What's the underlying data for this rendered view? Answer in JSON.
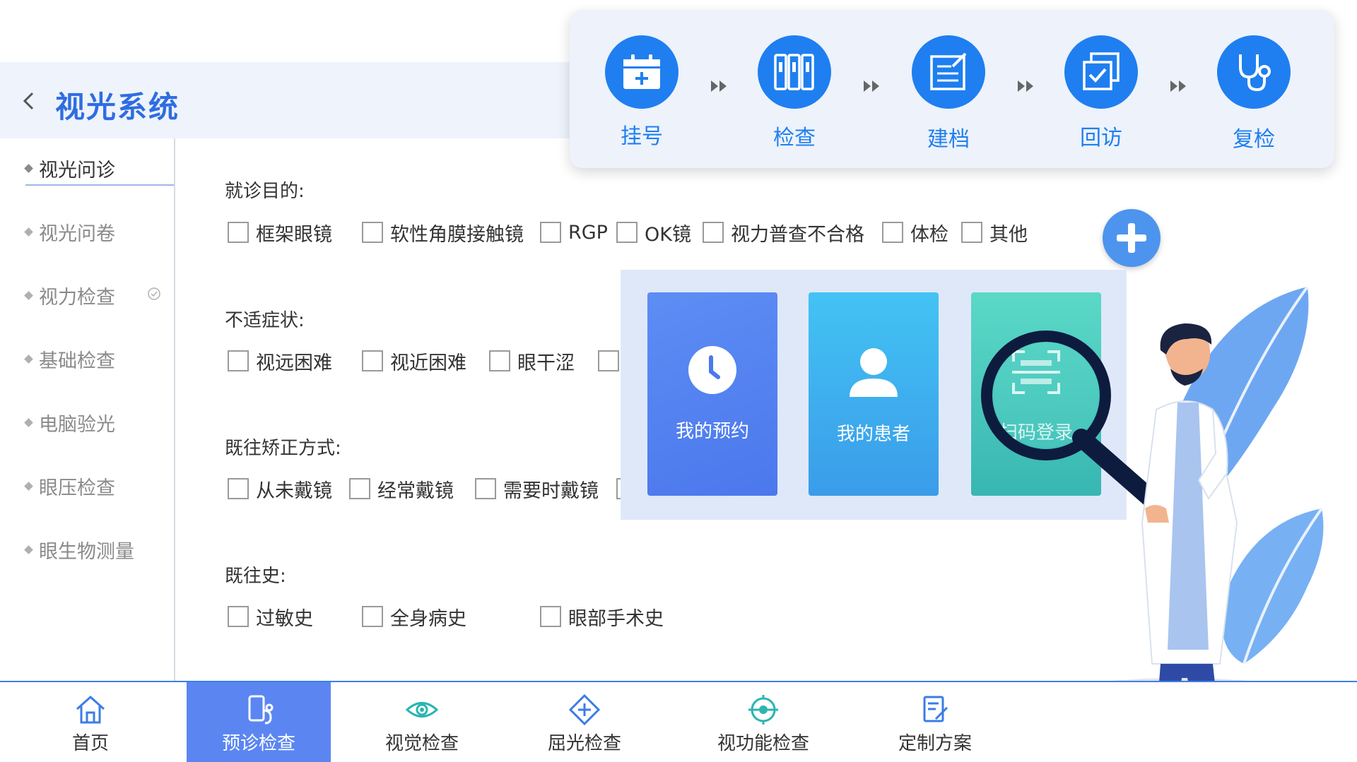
{
  "header": {
    "title": "视光系统",
    "back_icon": "chevron-left-icon"
  },
  "sidebar": {
    "items": [
      {
        "label": "视光问诊",
        "active": true
      },
      {
        "label": "视光问卷"
      },
      {
        "label": "视力检查",
        "icon": "check-circle-icon"
      },
      {
        "label": "基础检查"
      },
      {
        "label": "电脑验光"
      },
      {
        "label": "眼压检查"
      },
      {
        "label": "眼生物测量"
      }
    ]
  },
  "form": {
    "sections": [
      {
        "title": "就诊目的:",
        "options": [
          "框架眼镜",
          "软性角膜接触镜",
          "RGP",
          "OK镜",
          "视力普查不合格",
          "体检",
          "其他"
        ]
      },
      {
        "title": "不适症状:",
        "options": [
          "视远困难",
          "视近困难",
          "眼干涩"
        ]
      },
      {
        "title": "既往矫正方式:",
        "options": [
          "从未戴镜",
          "经常戴镜",
          "需要时戴镜"
        ]
      },
      {
        "title": "既往史:",
        "options": [
          "过敏史",
          "全身病史",
          "眼部手术史"
        ]
      }
    ]
  },
  "workflow": {
    "steps": [
      {
        "label": "挂号",
        "icon": "calendar-plus-icon"
      },
      {
        "label": "检查",
        "icon": "files-icon"
      },
      {
        "label": "建档",
        "icon": "document-edit-icon"
      },
      {
        "label": "回访",
        "icon": "checklist-icon"
      },
      {
        "label": "复检",
        "icon": "stethoscope-icon"
      }
    ],
    "arrow_icon": "double-arrow-icon"
  },
  "quick_panel": {
    "cards": [
      {
        "label": "我的预约",
        "icon": "clock-icon"
      },
      {
        "label": "我的患者",
        "icon": "user-icon"
      },
      {
        "label": "扫码登录",
        "icon": "scan-icon"
      }
    ],
    "add_icon": "plus-icon"
  },
  "bottom_nav": {
    "items": [
      {
        "label": "首页",
        "icon": "home-icon"
      },
      {
        "label": "预诊检查",
        "icon": "phone-stethoscope-icon",
        "active": true
      },
      {
        "label": "视觉检查",
        "icon": "eye-icon"
      },
      {
        "label": "屈光检查",
        "icon": "diamond-plus-icon"
      },
      {
        "label": "视功能检查",
        "icon": "eye-target-icon"
      },
      {
        "label": "定制方案",
        "icon": "clipboard-edit-icon"
      }
    ]
  },
  "colors": {
    "primary": "#1f7ff0",
    "title": "#2f6de1",
    "nav_active": "#5b86f2",
    "header_bg": "#eef3fc"
  }
}
